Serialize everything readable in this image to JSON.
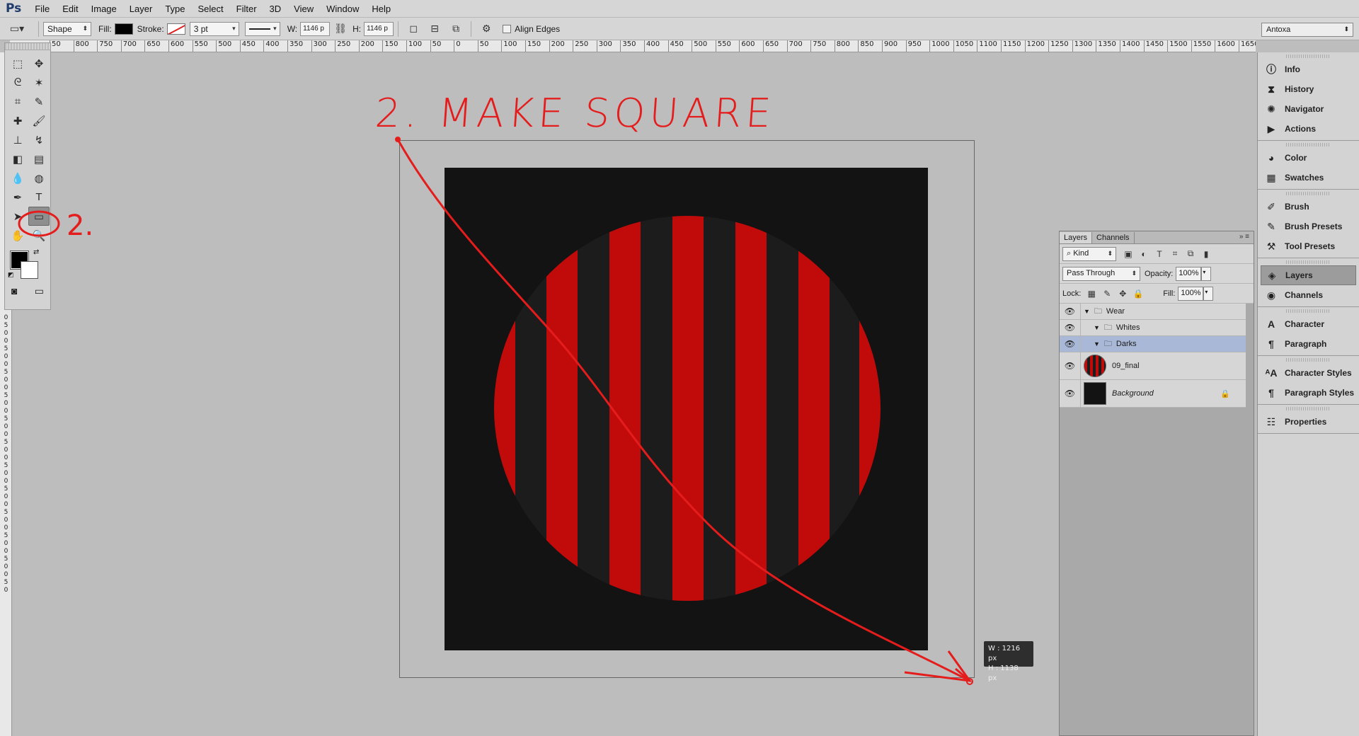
{
  "app": {
    "logo": "Ps"
  },
  "menu": [
    "File",
    "Edit",
    "Image",
    "Layer",
    "Type",
    "Select",
    "Filter",
    "3D",
    "View",
    "Window",
    "Help"
  ],
  "options": {
    "tool_mode": "Shape",
    "fill_label": "Fill:",
    "stroke_label": "Stroke:",
    "stroke_width": "3 pt",
    "w_label": "W:",
    "w_value": "1146 p",
    "h_label": "H:",
    "h_value": "1146 p",
    "align_edges": "Align Edges",
    "workspace": "Antoxa"
  },
  "ruler_top": [
    "50",
    "800",
    "750",
    "700",
    "650",
    "600",
    "550",
    "500",
    "450",
    "400",
    "350",
    "300",
    "250",
    "200",
    "150",
    "100",
    "50",
    "0",
    "50",
    "100",
    "150",
    "200",
    "250",
    "300",
    "350",
    "400",
    "450",
    "500",
    "550",
    "600",
    "650",
    "700",
    "750",
    "800",
    "850",
    "900",
    "950",
    "1000",
    "1050",
    "1100",
    "1150",
    "1200",
    "1250",
    "1300",
    "1350",
    "1400",
    "1450",
    "1500",
    "1550",
    "1600",
    "1650"
  ],
  "ruler_left": [
    "0",
    "5",
    "0",
    "0",
    "5",
    "0",
    "0",
    "5",
    "0",
    "0",
    "5",
    "0",
    "0",
    "5",
    "0",
    "0",
    "5",
    "0",
    "0",
    "5",
    "0",
    "0",
    "5",
    "0",
    "0",
    "5",
    "0",
    "0",
    "5",
    "0",
    "0",
    "5",
    "0",
    "0",
    "5",
    "0"
  ],
  "annotation": {
    "heading": "2. MAKE SQUARE",
    "tool_marker": "2."
  },
  "size_readout": {
    "w": "W :  1216 px",
    "h": "H :  1138 px"
  },
  "layers_panel": {
    "tabs": [
      "Layers",
      "Channels"
    ],
    "filter": "Kind",
    "blend_mode": "Pass Through",
    "opacity_label": "Opacity:",
    "opacity": "100%",
    "lock_label": "Lock:",
    "fill_label": "Fill:",
    "fill": "100%",
    "layers": [
      {
        "name": "Wear",
        "type": "group"
      },
      {
        "name": "Whites",
        "type": "group"
      },
      {
        "name": "Darks",
        "type": "group"
      },
      {
        "name": "09_final",
        "type": "smart"
      },
      {
        "name": "Background",
        "type": "background"
      }
    ]
  },
  "dock": {
    "groups": [
      [
        "Info",
        "History",
        "Navigator",
        "Actions"
      ],
      [
        "Color",
        "Swatches"
      ],
      [
        "Brush",
        "Brush Presets",
        "Tool Presets"
      ],
      [
        "Layers",
        "Channels"
      ],
      [
        "Character",
        "Paragraph"
      ],
      [
        "Character Styles",
        "Paragraph Styles"
      ],
      [
        "Properties"
      ]
    ],
    "active": "Layers"
  },
  "colors": {
    "accent": "#c10b0b",
    "annotation": "#e51c1c",
    "doc_bg": "#131313"
  }
}
